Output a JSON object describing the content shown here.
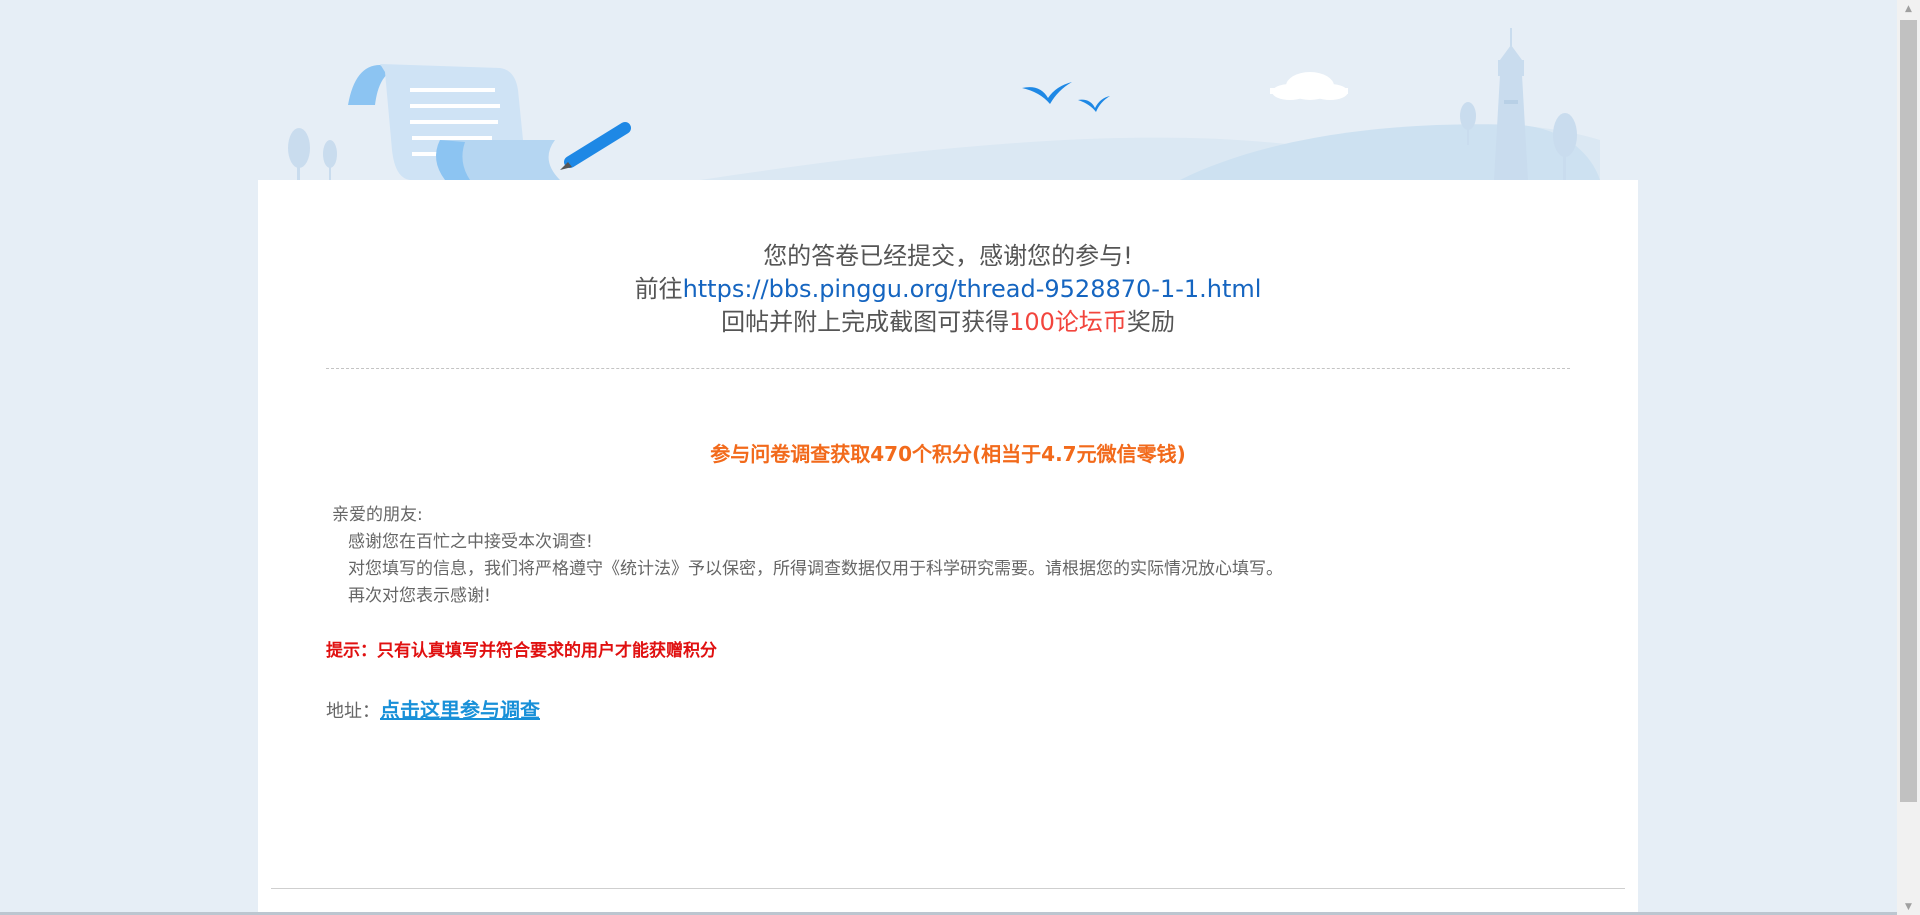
{
  "header": {
    "thank_you": "您的答卷已经提交，感谢您的参与!",
    "goto_prefix": "前往",
    "thread_link": "https://bbs.pinggu.org/thread-9528870-1-1.html",
    "reward_prefix": "回帖并附上完成截图可获得",
    "reward_amount": "100论坛币",
    "reward_suffix": "奖励"
  },
  "survey": {
    "title": "参与问卷调查获取470个积分(相当于4.7元微信零钱)",
    "greeting": "亲爱的朋友:",
    "lines": [
      "感谢您在百忙之中接受本次调查!",
      "对您填写的信息，我们将严格遵守《统计法》予以保密，所得调查数据仅用于科学研究需要。请根据您的实际情况放心填写。",
      "再次对您表示感谢!"
    ],
    "tip": "提示：只有认真填写并符合要求的用户才能获赠积分",
    "address_label": "地址：",
    "address_link": "点击这里参与调查"
  },
  "colors": {
    "background": "#e6eef6",
    "link_blue": "#1565c0",
    "reward_red": "#f2453d",
    "title_orange": "#f26a1b",
    "tip_red": "#e01010",
    "participate_link": "#1890d8"
  },
  "icons": {
    "banner": "survey-scroll-illustration",
    "birds": "bird-icon",
    "cloud": "cloud-icon",
    "lighthouse": "lighthouse-icon"
  }
}
